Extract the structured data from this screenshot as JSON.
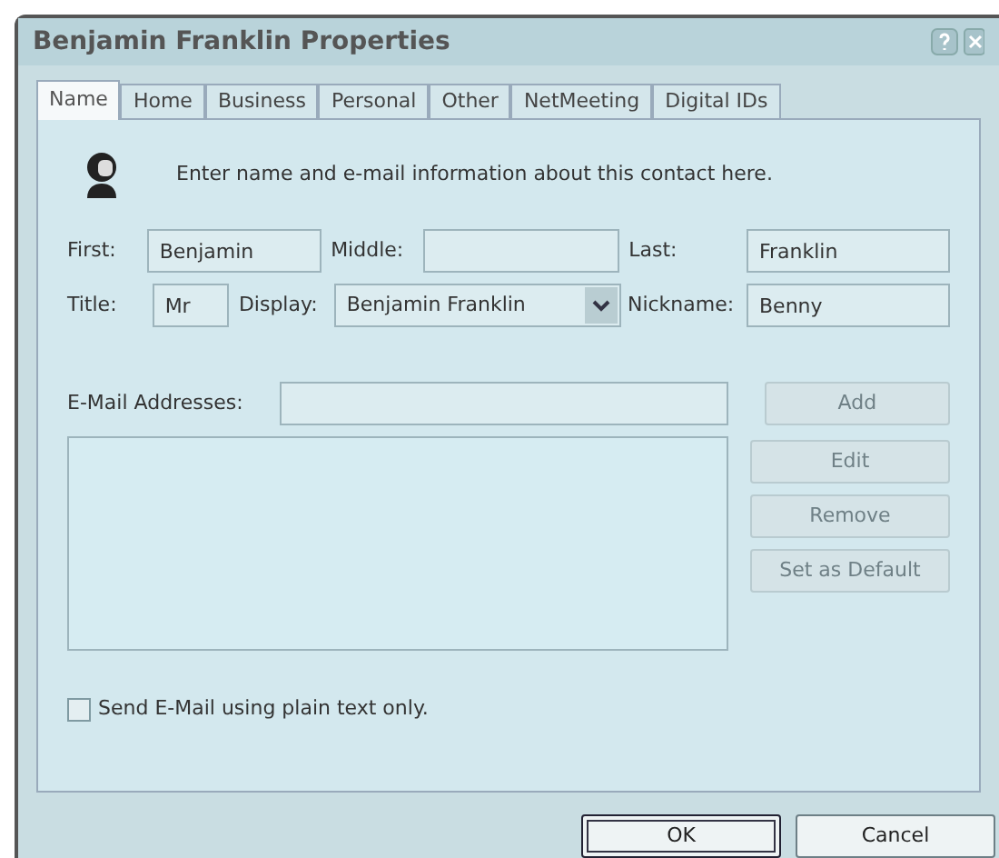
{
  "window": {
    "title": "Benjamin Franklin Properties"
  },
  "tabs": [
    {
      "label": "Name",
      "selected": true
    },
    {
      "label": "Home",
      "selected": false
    },
    {
      "label": "Business",
      "selected": false
    },
    {
      "label": "Personal",
      "selected": false
    },
    {
      "label": "Other",
      "selected": false
    },
    {
      "label": "NetMeeting",
      "selected": false
    },
    {
      "label": "Digital IDs",
      "selected": false
    }
  ],
  "intro": "Enter name and e-mail information about this contact here.",
  "name_fields": [
    {
      "label": "First:",
      "value": "Benjamin"
    },
    {
      "label": "Middle:"
    },
    {
      "label": "Last:",
      "value": "Franklin"
    }
  ],
  "title_field": {
    "label": "Title:",
    "value": "Mr"
  },
  "display_field": {
    "label": "Display:",
    "value": "Benjamin Franklin"
  },
  "nickname_field": {
    "label": "Nickname:",
    "value": "Benny"
  },
  "email": {
    "label": "E-Mail Addresses:"
  },
  "email_buttons": [
    {
      "label": "Add",
      "disabled": true
    },
    {
      "label": "Edit",
      "disabled": true
    },
    {
      "label": "Remove",
      "disabled": true
    },
    {
      "label": "Set as Default",
      "disabled": true
    }
  ],
  "plain_text": {
    "label": "Send E-Mail using plain text only.",
    "checked": false
  },
  "buttons": [
    {
      "label": "OK",
      "default": true
    },
    {
      "label": "Cancel",
      "default": false
    }
  ]
}
